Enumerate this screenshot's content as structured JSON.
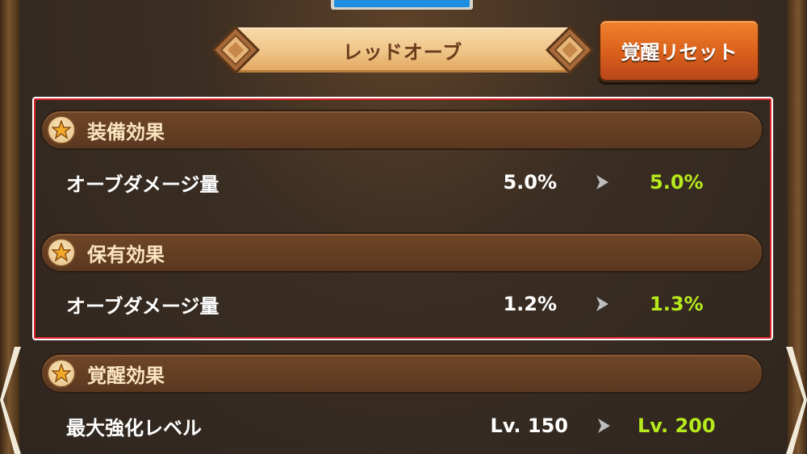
{
  "title": "レッドオーブ",
  "reset_button": "覚醒リセット",
  "sections": [
    {
      "header": "装備効果",
      "icon": "star-icon",
      "rows": [
        {
          "label": "オーブダメージ量",
          "current": "5.0%",
          "next": "5.0%"
        }
      ]
    },
    {
      "header": "保有効果",
      "icon": "star-icon",
      "rows": [
        {
          "label": "オーブダメージ量",
          "current": "1.2%",
          "next": "1.3%"
        }
      ]
    },
    {
      "header": "覚醒効果",
      "icon": "star-icon",
      "rows": [
        {
          "label": "最大強化レベル",
          "current": "Lv. 150",
          "next": "Lv. 200"
        }
      ]
    }
  ],
  "colors": {
    "next_value": "#b6ea1c",
    "highlight_border": "#e0222a",
    "reset_button": "#d9601b",
    "title_ribbon": "#f0c487"
  }
}
